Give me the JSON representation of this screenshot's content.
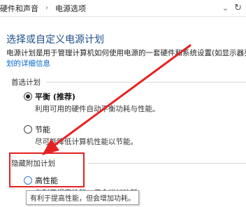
{
  "breadcrumb": {
    "items": [
      "硬件和声音",
      "电源选项"
    ],
    "separator_glyph": "›",
    "dropdown_icon": "chevron-down-icon",
    "refresh_icon": "refresh-icon"
  },
  "main": {
    "title": "选择或自定义电源计划",
    "description_line1": "电源计划是用于管理计算机如何使用电源的一套硬件和系统设置(如显示器亮",
    "description_link": "划的详细信息"
  },
  "preferred_plans": {
    "section_label": "首选计划",
    "plans": [
      {
        "name": "平衡 (推荐)",
        "description": "利用可用的硬件自动平衡功耗与性能。",
        "selected": true
      },
      {
        "name": "节能",
        "description": "尽可能降低计算机性能以节能。",
        "selected": false
      }
    ]
  },
  "hidden_plans": {
    "section_label": "隐藏附加计划",
    "plans": [
      {
        "name": "高性能",
        "description": "有利于提高性能，但会增加功耗",
        "selected": false
      }
    ]
  },
  "tooltip": {
    "text": "有利于提高性能，但会增加功耗。"
  },
  "colors": {
    "title": "#1e4e8c",
    "link": "#0066cc",
    "annotation_red": "#e52222"
  }
}
